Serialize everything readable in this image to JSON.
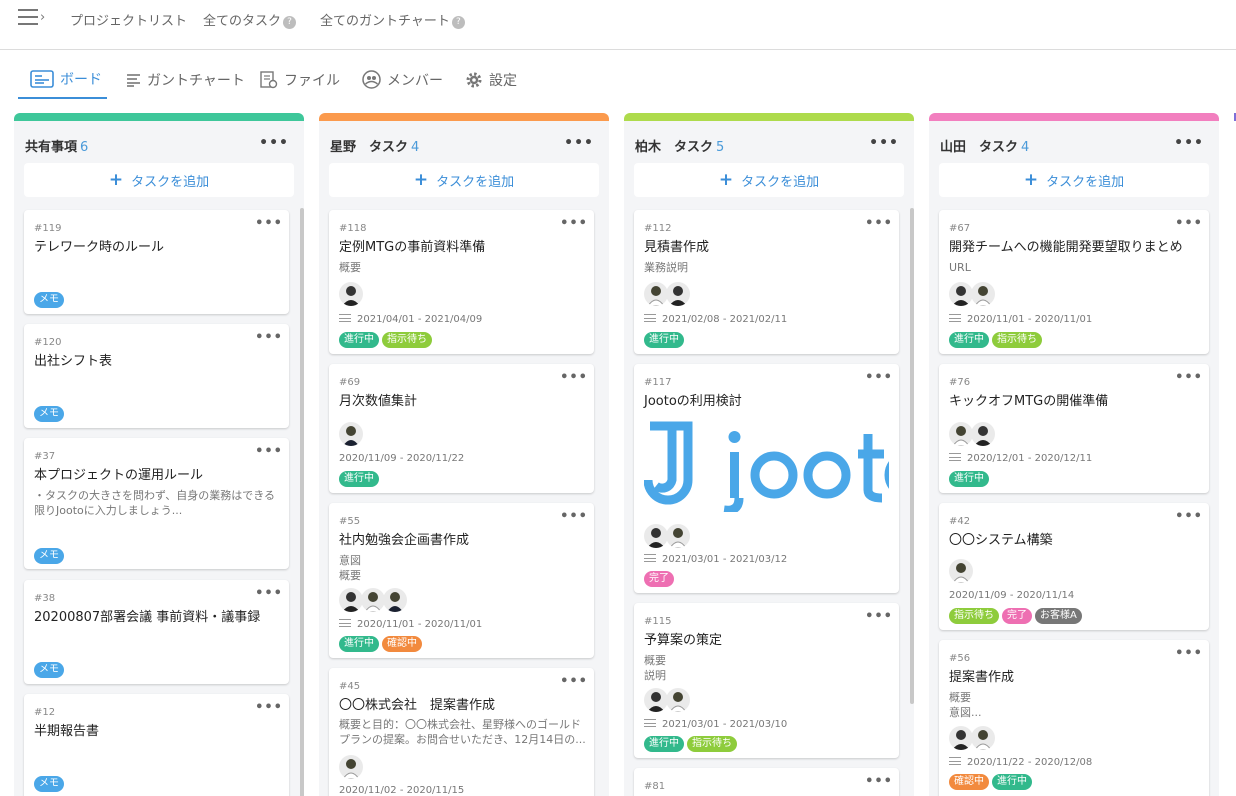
{
  "topnav": {
    "project_list": "プロジェクトリスト",
    "all_tasks": "全てのタスク",
    "all_gantt": "全てのガントチャート",
    "help": "?"
  },
  "tabs": [
    {
      "label": "ボード"
    },
    {
      "label": "ガントチャート"
    },
    {
      "label": "ファイル"
    },
    {
      "label": "メンバー"
    },
    {
      "label": "設定"
    }
  ],
  "add_task_label": "タスクを追加",
  "more": "•••",
  "colors": {
    "accent": "#3b8ed8",
    "col0": "#3ec79a",
    "col1": "#fb9a4d",
    "col2": "#aedb4c",
    "col3": "#f27fbf",
    "tag_memo": "#4aa7e8",
    "tag_progress": "#32b98c",
    "tag_waiting": "#8ecc3c",
    "tag_checking": "#f28a3e",
    "tag_done": "#ee6fb2",
    "tag_client": "#777777"
  },
  "columns": [
    {
      "title": "共有事項",
      "count": "6",
      "cards": [
        {
          "id": "#119",
          "title": "テレワーク時のルール",
          "tags": [
            "メモ"
          ]
        },
        {
          "id": "#120",
          "title": "出社シフト表",
          "tags": [
            "メモ"
          ]
        },
        {
          "id": "#37",
          "title": "本プロジェクトの運用ルール",
          "desc": [
            "・タスクの大きさを問わず、自身の業務はできる",
            "限りJootoに入力しましょう..."
          ],
          "tags": [
            "メモ"
          ]
        },
        {
          "id": "#38",
          "title": "20200807部署会議 事前資料・議事録",
          "tags": [
            "メモ"
          ]
        },
        {
          "id": "#12",
          "title": "半期報告書",
          "tags": [
            "メモ"
          ]
        }
      ]
    },
    {
      "title": "星野　タスク",
      "count": "4",
      "cards": [
        {
          "id": "#118",
          "title": "定例MTGの事前資料準備",
          "desc": [
            "概要"
          ],
          "date": "2021/04/01 - 2021/04/09",
          "tags": [
            "進行中",
            "指示待ち"
          ]
        },
        {
          "id": "#69",
          "title": "月次数値集計",
          "date": "2020/11/09 - 2020/11/22",
          "tags": [
            "進行中"
          ]
        },
        {
          "id": "#55",
          "title": "社内勉強会企画書作成",
          "desc": [
            "意図",
            "概要"
          ],
          "date": "2020/11/01 - 2020/11/01",
          "tags": [
            "進行中",
            "確認中"
          ]
        },
        {
          "id": "#45",
          "title": "〇〇株式会社　提案書作成",
          "desc": [
            "概要と目的：〇〇株式会社、星野様へのゴールド",
            "プランの提案。お問合せいただき、12月14日の..."
          ],
          "date": "2020/11/02 - 2020/11/15"
        }
      ]
    },
    {
      "title": "柏木　タスク",
      "count": "5",
      "cards": [
        {
          "id": "#112",
          "title": "見積書作成",
          "desc": [
            "業務説明"
          ],
          "date": "2021/02/08 - 2021/02/11",
          "tags": [
            "進行中"
          ]
        },
        {
          "id": "#117",
          "title": "Jootoの利用検討",
          "date": "2021/03/01 - 2021/03/12",
          "tags": [
            "完了"
          ]
        },
        {
          "id": "#115",
          "title": "予算案の策定",
          "desc": [
            "概要",
            "説明"
          ],
          "date": "2021/03/01 - 2021/03/10",
          "tags": [
            "進行中",
            "指示待ち"
          ]
        },
        {
          "id": "#81"
        }
      ]
    },
    {
      "title": "山田　タスク",
      "count": "4",
      "cards": [
        {
          "id": "#67",
          "title": "開発チームへの機能開発要望取りまとめ",
          "desc": [
            "URL"
          ],
          "date": "2020/11/01 - 2020/11/01",
          "tags": [
            "進行中",
            "指示待ち"
          ]
        },
        {
          "id": "#76",
          "title": "キックオフMTGの開催準備",
          "date": "2020/12/01 - 2020/12/11",
          "tags": [
            "進行中"
          ]
        },
        {
          "id": "#42",
          "title": "〇〇システム構築",
          "date": "2020/11/09 - 2020/11/14",
          "tags": [
            "指示待ち",
            "完了",
            "お客様A"
          ]
        },
        {
          "id": "#56",
          "title": "提案書作成",
          "desc": [
            "概要",
            "意図..."
          ],
          "date": "2020/11/22 - 2020/12/08",
          "tags": [
            "確認中",
            "進行中"
          ]
        }
      ]
    }
  ]
}
